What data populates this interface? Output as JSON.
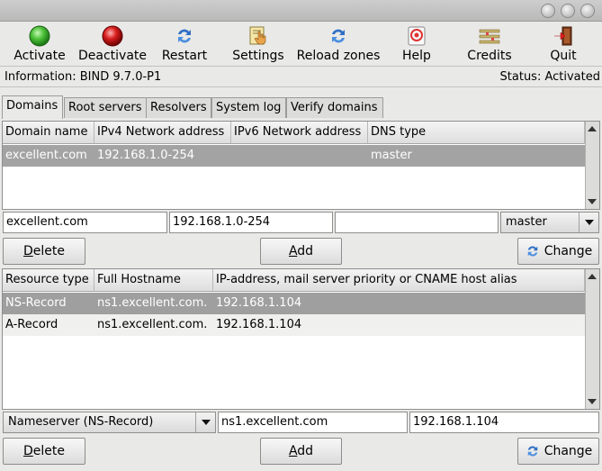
{
  "toolbar": {
    "activate": "Activate",
    "deactivate": "Deactivate",
    "restart": "Restart",
    "settings": "Settings",
    "reload": "Reload zones",
    "help": "Help",
    "credits": "Credits",
    "quit": "Quit"
  },
  "info": {
    "left": "Information: BIND 9.7.0-P1",
    "right": "Status: Activated"
  },
  "tabs": [
    "Domains",
    "Root servers",
    "Resolvers",
    "System log",
    "Verify domains"
  ],
  "domains": {
    "headers": [
      "Domain name",
      "IPv4 Network address",
      "IPv6 Network address",
      "DNS type"
    ],
    "rows": [
      [
        "excellent.com",
        "192.168.1.0-254",
        "",
        "master"
      ]
    ],
    "input_domain": "excellent.com",
    "input_ipv4": "192.168.1.0-254",
    "input_ipv6": "",
    "type_selected": "master",
    "delete_first": "D",
    "delete_rest": "elete",
    "add_first": "A",
    "add_rest": "dd",
    "change_label": "Change"
  },
  "records": {
    "headers": [
      "Resource type",
      "Full Hostname",
      "IP-address, mail server priority or CNAME host alias"
    ],
    "rows": [
      [
        "NS-Record",
        "ns1.excellent.com.",
        "192.168.1.104"
      ],
      [
        "A-Record",
        "ns1.excellent.com.",
        "192.168.1.104"
      ]
    ],
    "type_selected": "Nameserver (NS-Record)",
    "input_host": "ns1.excellent.com",
    "input_ip": "192.168.1.104",
    "delete_first": "D",
    "delete_rest": "elete",
    "add_first": "A",
    "add_rest": "dd",
    "change_label": "Change"
  },
  "colors": {
    "window_bg": "#e9e9e7",
    "selected_row": "#a3a3a3",
    "activate_icon": "#3cb043",
    "deactivate_icon": "#d21313"
  }
}
